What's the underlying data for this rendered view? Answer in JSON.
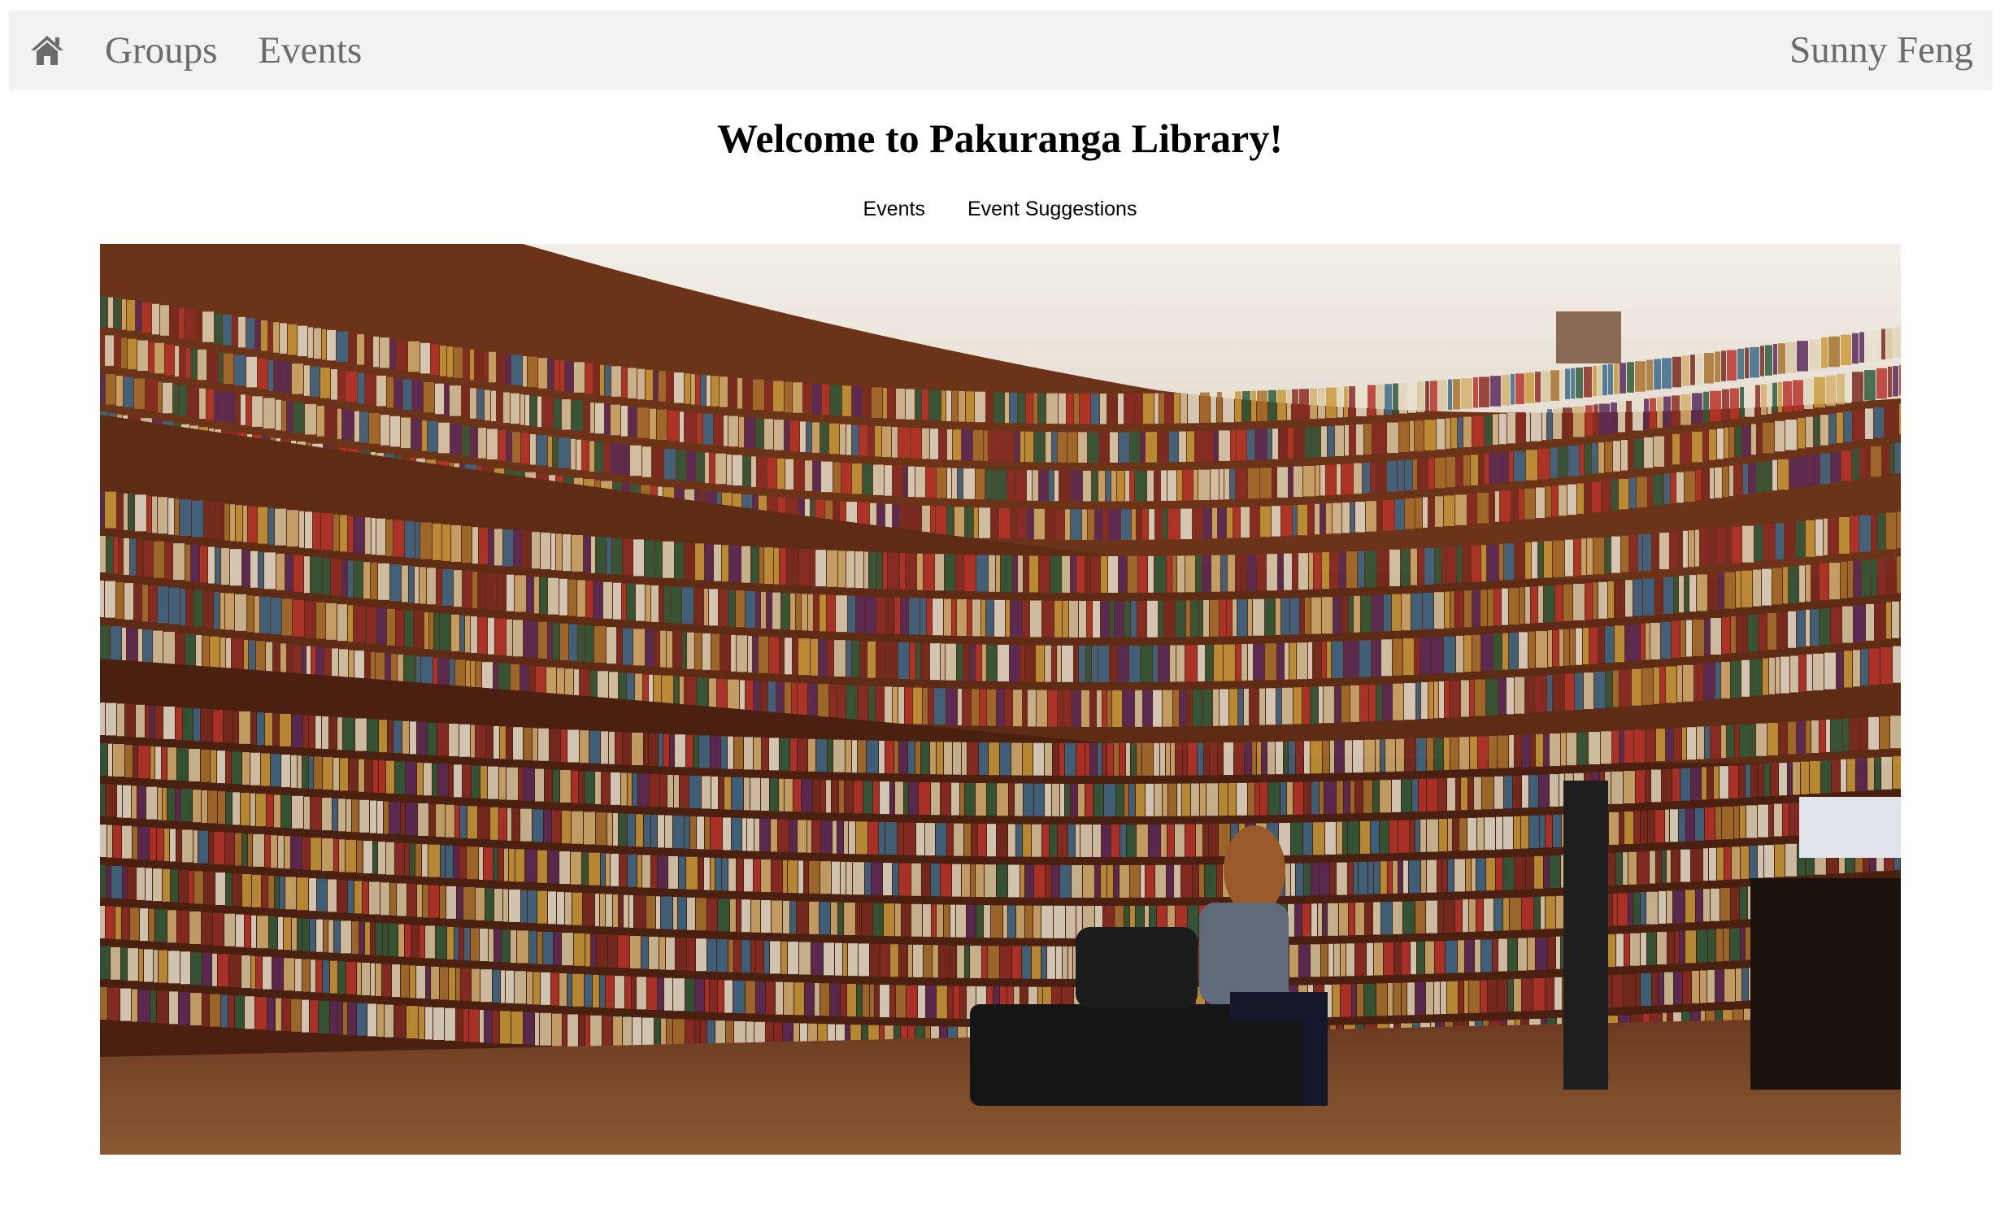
{
  "navbar": {
    "home_icon": "home-icon",
    "links": [
      "Groups",
      "Events"
    ],
    "user_name": "Sunny Feng"
  },
  "page": {
    "title": "Welcome to Pakuranga Library!",
    "subnav": [
      "Events",
      "Event Suggestions"
    ]
  },
  "hero": {
    "image": "library-interior-photo"
  },
  "colors": {
    "navbar_bg": "#f2f2f2",
    "nav_text": "#6b6b6b",
    "shelf_wood": "#6b3418",
    "floor": "#7a4a28"
  }
}
